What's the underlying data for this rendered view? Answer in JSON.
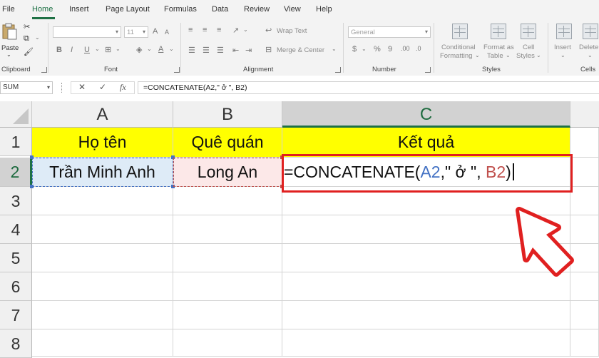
{
  "menu": {
    "items": [
      "File",
      "Home",
      "Insert",
      "Page Layout",
      "Formulas",
      "Data",
      "Review",
      "View",
      "Help"
    ],
    "active": "Home"
  },
  "ribbon": {
    "clipboard": {
      "paste_label": "Paste",
      "group_label": "Clipboard"
    },
    "font": {
      "size_value": "11",
      "group_label": "Font"
    },
    "alignment": {
      "wrap_text": "Wrap Text",
      "merge_center": "Merge & Center",
      "group_label": "Alignment"
    },
    "number": {
      "format_value": "General",
      "group_label": "Number"
    },
    "styles": {
      "conditional_1": "Conditional",
      "conditional_2": "Formatting",
      "format_as_1": "Format as",
      "format_as_2": "Table",
      "cell_1": "Cell",
      "cell_2": "Styles",
      "group_label": "Styles"
    },
    "cells": {
      "insert": "Insert",
      "delete": "Delete",
      "group_label": "Cells"
    }
  },
  "formula_bar": {
    "name_box": "SUM",
    "fx": "fx",
    "formula": "=CONCATENATE(A2,\" ở \", B2)"
  },
  "columns": [
    "A",
    "B",
    "C"
  ],
  "rows": [
    "1",
    "2",
    "3",
    "4",
    "5",
    "6",
    "7",
    "8"
  ],
  "sheet": {
    "header": {
      "a": "Họ tên",
      "b": "Quê quán",
      "c": "Kết quả"
    },
    "row2": {
      "a": "Trần Minh Anh",
      "b": "Long An",
      "c_prefix": "=CONCATENATE(",
      "c_ref1": "A2",
      "c_mid": ",\" ở \", ",
      "c_ref2": "B2",
      "c_suffix": ")"
    }
  },
  "colors": {
    "accent_green": "#1e7145",
    "header_fill": "#ffff00",
    "ref_a": "#4472c4",
    "ref_b": "#c0504d",
    "annotation_red": "#e02020"
  }
}
